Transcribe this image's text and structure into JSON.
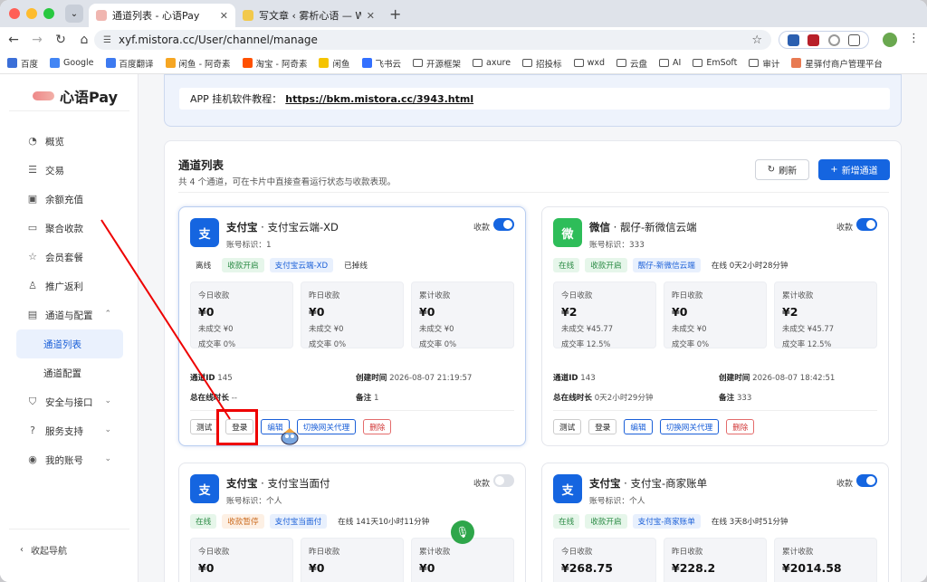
{
  "browser": {
    "tabs": [
      {
        "label": "通道列表 - 心语Pay",
        "active": true
      },
      {
        "label": "写文章 ‹ 雾析心语 — WordPress",
        "active": false
      }
    ],
    "url": "xyf.mistora.cc/User/channel/manage",
    "bookmarks": [
      "百度",
      "Google",
      "百度翻译",
      "闲鱼 - 阿奇素",
      "淘宝 - 阿奇素",
      "闲鱼",
      "飞书云",
      "开源框架",
      "axure",
      "招投标",
      "wxd",
      "云盘",
      "AI",
      "EmSoft",
      "审计",
      "星驿付商户管理平台"
    ]
  },
  "sidebar": {
    "logo": "心语Pay",
    "items": [
      {
        "label": "概览",
        "icon": "dashboard-icon"
      },
      {
        "label": "交易",
        "icon": "list-icon"
      },
      {
        "label": "余额充值",
        "icon": "wallet-icon"
      },
      {
        "label": "聚合收款",
        "icon": "card-icon"
      },
      {
        "label": "会员套餐",
        "icon": "star-icon"
      },
      {
        "label": "推广返利",
        "icon": "users-icon"
      },
      {
        "label": "通道与配置",
        "icon": "server-icon",
        "expanded": true
      }
    ],
    "sub_items": [
      "通道列表",
      "通道配置"
    ],
    "items_after": [
      {
        "label": "安全与接口",
        "icon": "shield-icon"
      },
      {
        "label": "服务支持",
        "icon": "help-icon"
      },
      {
        "label": "我的账号",
        "icon": "user-icon"
      }
    ],
    "collapse": "收起导航"
  },
  "notice": {
    "label": "APP 挂机软件教程：",
    "link": "https://bkm.mistora.cc/3943.html"
  },
  "panel": {
    "title": "通道列表",
    "subtitle": "共 4 个通道，可在卡片中直接查看运行状态与收款表现。",
    "refresh": "刷新",
    "add": "新增通道"
  },
  "labels": {
    "toggle": "收款",
    "account_prefix": "账号标识：",
    "today": "今日收款",
    "yesterday": "昨日收款",
    "total": "累计收款",
    "channel_id": "通道ID",
    "created": "创建时间",
    "online_total": "总在线时长",
    "remark": "备注",
    "actions": [
      "测试",
      "登录",
      "编辑",
      "切换网关代理",
      "删除"
    ]
  },
  "cards": [
    {
      "icon": "支",
      "color": "#1565e0",
      "type": "支付宝",
      "name": "支付宝云端-XD",
      "account": "1",
      "enabled": true,
      "tags": [
        {
          "t": "离线",
          "c": "plain"
        },
        {
          "t": "收款开启",
          "c": "green"
        },
        {
          "t": "支付宝云端-XD",
          "c": "blue"
        },
        {
          "t": "已掉线",
          "c": "plain"
        }
      ],
      "stats": [
        {
          "v": "¥0",
          "a": "未成交 ¥0",
          "r": "成交率 0%"
        },
        {
          "v": "¥0",
          "a": "未成交 ¥0",
          "r": "成交率 0%"
        },
        {
          "v": "¥0",
          "a": "未成交 ¥0",
          "r": "成交率 0%"
        }
      ],
      "id": "145",
      "created": "2026-08-07 21:19:57",
      "online": "--",
      "remark": "1"
    },
    {
      "icon": "微",
      "color": "#2ebd59",
      "type": "微信",
      "name": "靓仔-新微信云端",
      "account": "333",
      "enabled": true,
      "tags": [
        {
          "t": "在线",
          "c": "green"
        },
        {
          "t": "收款开启",
          "c": "green"
        },
        {
          "t": "靓仔-新微信云端",
          "c": "blue"
        },
        {
          "t": "在线 0天2小时28分钟",
          "c": "plain"
        }
      ],
      "stats": [
        {
          "v": "¥2",
          "a": "未成交 ¥45.77",
          "r": "成交率 12.5%"
        },
        {
          "v": "¥0",
          "a": "未成交 ¥0",
          "r": "成交率 0%"
        },
        {
          "v": "¥2",
          "a": "未成交 ¥45.77",
          "r": "成交率 12.5%"
        }
      ],
      "id": "143",
      "created": "2026-08-07 18:42:51",
      "online": "0天2小时29分钟",
      "remark": "333"
    },
    {
      "icon": "支",
      "color": "#1565e0",
      "type": "支付宝",
      "name": "支付宝当面付",
      "account": "个人",
      "enabled": false,
      "tags": [
        {
          "t": "在线",
          "c": "green"
        },
        {
          "t": "收款暂停",
          "c": "orange"
        },
        {
          "t": "支付宝当面付",
          "c": "blue"
        },
        {
          "t": "在线 141天10小时11分钟",
          "c": "plain"
        }
      ],
      "stats": [
        {
          "v": "¥0"
        },
        {
          "v": "¥0"
        },
        {
          "v": "¥0"
        }
      ]
    },
    {
      "icon": "支",
      "color": "#1565e0",
      "type": "支付宝",
      "name": "支付宝-商家账单",
      "account": "个人",
      "enabled": true,
      "tags": [
        {
          "t": "在线",
          "c": "green"
        },
        {
          "t": "收款开启",
          "c": "green"
        },
        {
          "t": "支付宝-商家账单",
          "c": "blue"
        },
        {
          "t": "在线 3天8小时51分钟",
          "c": "plain"
        }
      ],
      "stats": [
        {
          "v": "¥268.75"
        },
        {
          "v": "¥228.2"
        },
        {
          "v": "¥2014.58"
        }
      ]
    }
  ],
  "colors": {
    "primary": "#1565e0",
    "success": "#2ea64a",
    "highlight": "#e00000"
  }
}
